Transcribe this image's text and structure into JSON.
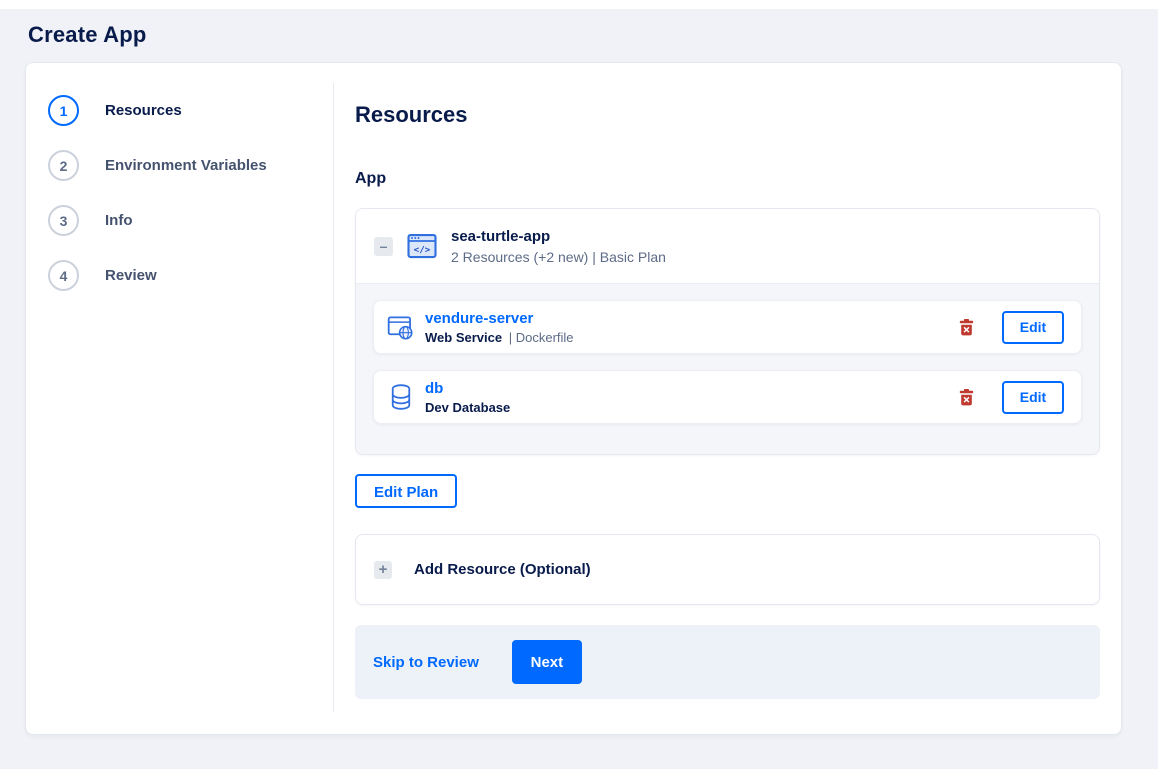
{
  "page": {
    "title": "Create App"
  },
  "stepper": {
    "steps": [
      {
        "number": "1",
        "label": "Resources",
        "active": true
      },
      {
        "number": "2",
        "label": "Environment Variables",
        "active": false
      },
      {
        "number": "3",
        "label": "Info",
        "active": false
      },
      {
        "number": "4",
        "label": "Review",
        "active": false
      }
    ]
  },
  "content": {
    "heading": "Resources",
    "section_label": "App",
    "app_card": {
      "collapse_glyph": "–",
      "name": "sea-turtle-app",
      "summary": "2 Resources (+2 new) | Basic Plan",
      "resources": [
        {
          "name": "vendure-server",
          "type": "Web Service",
          "separator": "|",
          "source": "Dockerfile",
          "icon": "web-service-icon",
          "edit_label": "Edit"
        },
        {
          "name": "db",
          "type": "Dev Database",
          "icon": "database-icon",
          "edit_label": "Edit"
        }
      ]
    },
    "edit_plan_label": "Edit Plan",
    "add_resource": {
      "plus_glyph": "+",
      "label": "Add Resource (Optional)"
    },
    "footer": {
      "skip_label": "Skip to Review",
      "next_label": "Next"
    }
  },
  "colors": {
    "accent_blue": "#0069ff",
    "navy_text": "#081b4b",
    "secondary_text": "#5e6b87",
    "danger_red": "#c0392f",
    "page_background": "#f0f2f7",
    "card_body_background": "#f4f6fa",
    "footer_background": "#edf2f9"
  }
}
